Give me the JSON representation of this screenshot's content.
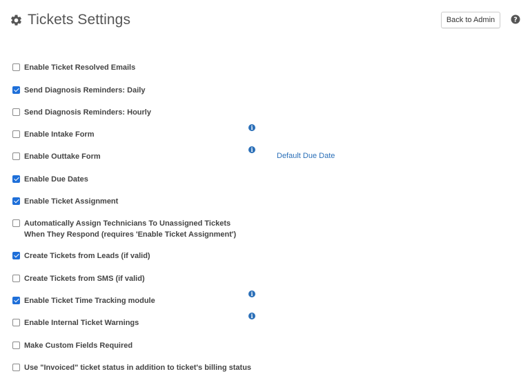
{
  "header": {
    "title": "Tickets Settings",
    "back_button_label": "Back to Admin",
    "icon": "gear-icon",
    "help_icon": "question-circle-icon"
  },
  "settings": [
    {
      "label": "Enable Ticket Resolved Emails",
      "checked": false
    },
    {
      "label": "Send Diagnosis Reminders: Daily",
      "checked": true
    },
    {
      "label": "Send Diagnosis Reminders: Hourly",
      "checked": false
    },
    {
      "label": "Enable Intake Form",
      "checked": false
    },
    {
      "label": "Enable Outtake Form",
      "checked": false
    },
    {
      "label": "Enable Due Dates",
      "checked": true
    },
    {
      "label": "Enable Ticket Assignment",
      "checked": true
    },
    {
      "label": "Automatically Assign Technicians To Unassigned Tickets When They Respond (requires 'Enable Ticket Assignment')",
      "checked": false
    },
    {
      "label": "Create Tickets from Leads (if valid)",
      "checked": true
    },
    {
      "label": "Create Tickets from SMS (if valid)",
      "checked": false
    },
    {
      "label": "Enable Ticket Time Tracking module",
      "checked": true
    },
    {
      "label": "Enable Internal Ticket Warnings",
      "checked": false
    },
    {
      "label": "Make Custom Fields Required",
      "checked": false
    },
    {
      "label": "Use \"Invoiced\" ticket status in addition to ticket's billing status",
      "checked": false
    }
  ],
  "links": {
    "default_due_date": "Default Due Date"
  },
  "info_icon_glyph": "i",
  "colors": {
    "accent": "#2a6fb8",
    "checkbox_checked": "#1e6fd9",
    "title": "#555555"
  }
}
